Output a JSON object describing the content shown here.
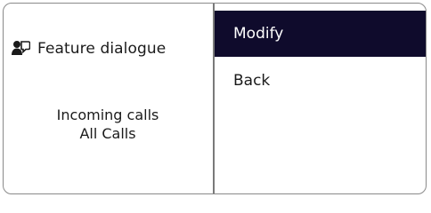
{
  "dialog": {
    "title": "Feature dialogue",
    "title_icon": "user-speech-bubble-icon",
    "status_line_1": "Incoming calls",
    "status_line_2": "All Calls"
  },
  "menu": {
    "items": [
      {
        "label": "Modify",
        "selected": true
      },
      {
        "label": "Back",
        "selected": false
      }
    ],
    "selected_bg": "#0f0b2c"
  }
}
